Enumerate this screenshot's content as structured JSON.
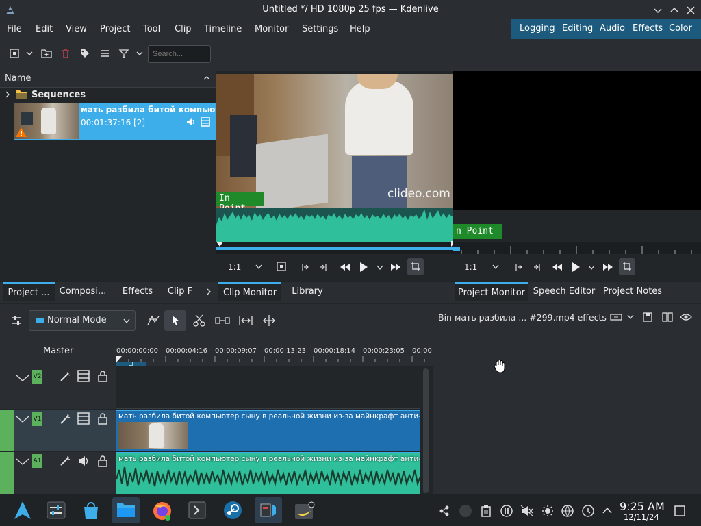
{
  "window": {
    "title": "Untitled */ HD 1080p 25 fps — Kdenlive"
  },
  "menu": [
    "File",
    "Edit",
    "View",
    "Project",
    "Tool",
    "Clip",
    "Timeline",
    "Monitor",
    "Settings",
    "Help"
  ],
  "layouts": [
    "Logging",
    "Editing",
    "Audio",
    "Effects",
    "Color"
  ],
  "bin": {
    "search_placeholder": "Search...",
    "column_name": "Name",
    "folder": "Sequences",
    "clip_name": "мать разбила битой компьют",
    "clip_duration": "00:01:37:16 [2]"
  },
  "left_tabs": [
    "Project ...",
    "Composi...",
    "Effects",
    "Clip F"
  ],
  "clip_monitor": {
    "watermark": "clideo.com",
    "in_point": "In Point",
    "zoom": "1:1"
  },
  "project_monitor": {
    "in_point": "n Point",
    "zoom": "1:1"
  },
  "middle_tabs": [
    "Clip Monitor",
    "Library"
  ],
  "right_tabs": [
    "Project Monitor",
    "Speech Editor",
    "Project Notes"
  ],
  "timeline": {
    "mode": "Normal Mode",
    "master_label": "Master",
    "timecodes": [
      "00:00:00:00",
      "00:00:04:16",
      "00:00:09:07",
      "00:00:13:23",
      "00:00:18:14",
      "00:00:23:05",
      "00:00:"
    ],
    "tracks": [
      {
        "tag": "V2",
        "clip": ""
      },
      {
        "tag": "V1",
        "clip": "мать разбила битой компьютер сыну в реальной жизни из-за майнкрафт анти-гри"
      },
      {
        "tag": "A1",
        "clip": "мать разбила битой компьютер сыну в реальной жизни из-за майнкрафт анти-гри"
      }
    ]
  },
  "effects_panel": {
    "title": "Bin мать разбила ... #299.mp4 effects"
  },
  "tray": {
    "time": "9:25 AM",
    "date": "12/11/24"
  },
  "colors": {
    "accent": "#3daee9",
    "clip_video": "#1e6fb0",
    "clip_audio": "#2fbf9a",
    "track_tag": "#5cb15c"
  }
}
